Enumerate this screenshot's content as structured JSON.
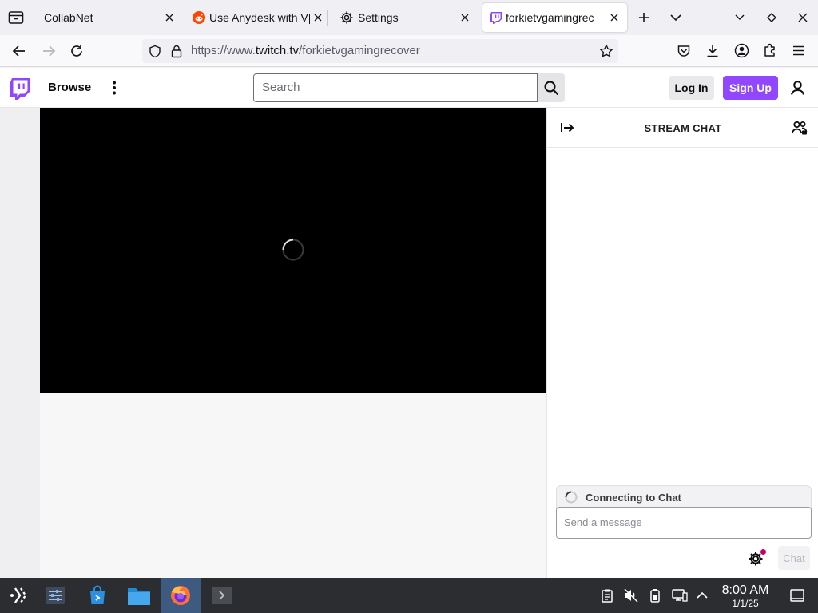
{
  "browser": {
    "tabs": [
      {
        "title": "CollabNet",
        "active": false
      },
      {
        "title": "Use Anydesk with V|",
        "active": false
      },
      {
        "title": "Settings",
        "active": false
      },
      {
        "title": "forkietvgamingrec",
        "active": true
      }
    ],
    "url_prefix": "https://www.",
    "url_domain": "twitch.tv",
    "url_path": "/forkietvgamingrecover"
  },
  "twitch": {
    "browse_label": "Browse",
    "search_placeholder": "Search",
    "login_label": "Log In",
    "signup_label": "Sign Up",
    "accent_color": "#9147ff"
  },
  "chat": {
    "title": "STREAM CHAT",
    "connecting_text": "Connecting to Chat",
    "message_placeholder": "Send a message",
    "chat_button": "Chat"
  },
  "taskbar": {
    "time": "8:00 AM",
    "date": "1/1/25"
  }
}
